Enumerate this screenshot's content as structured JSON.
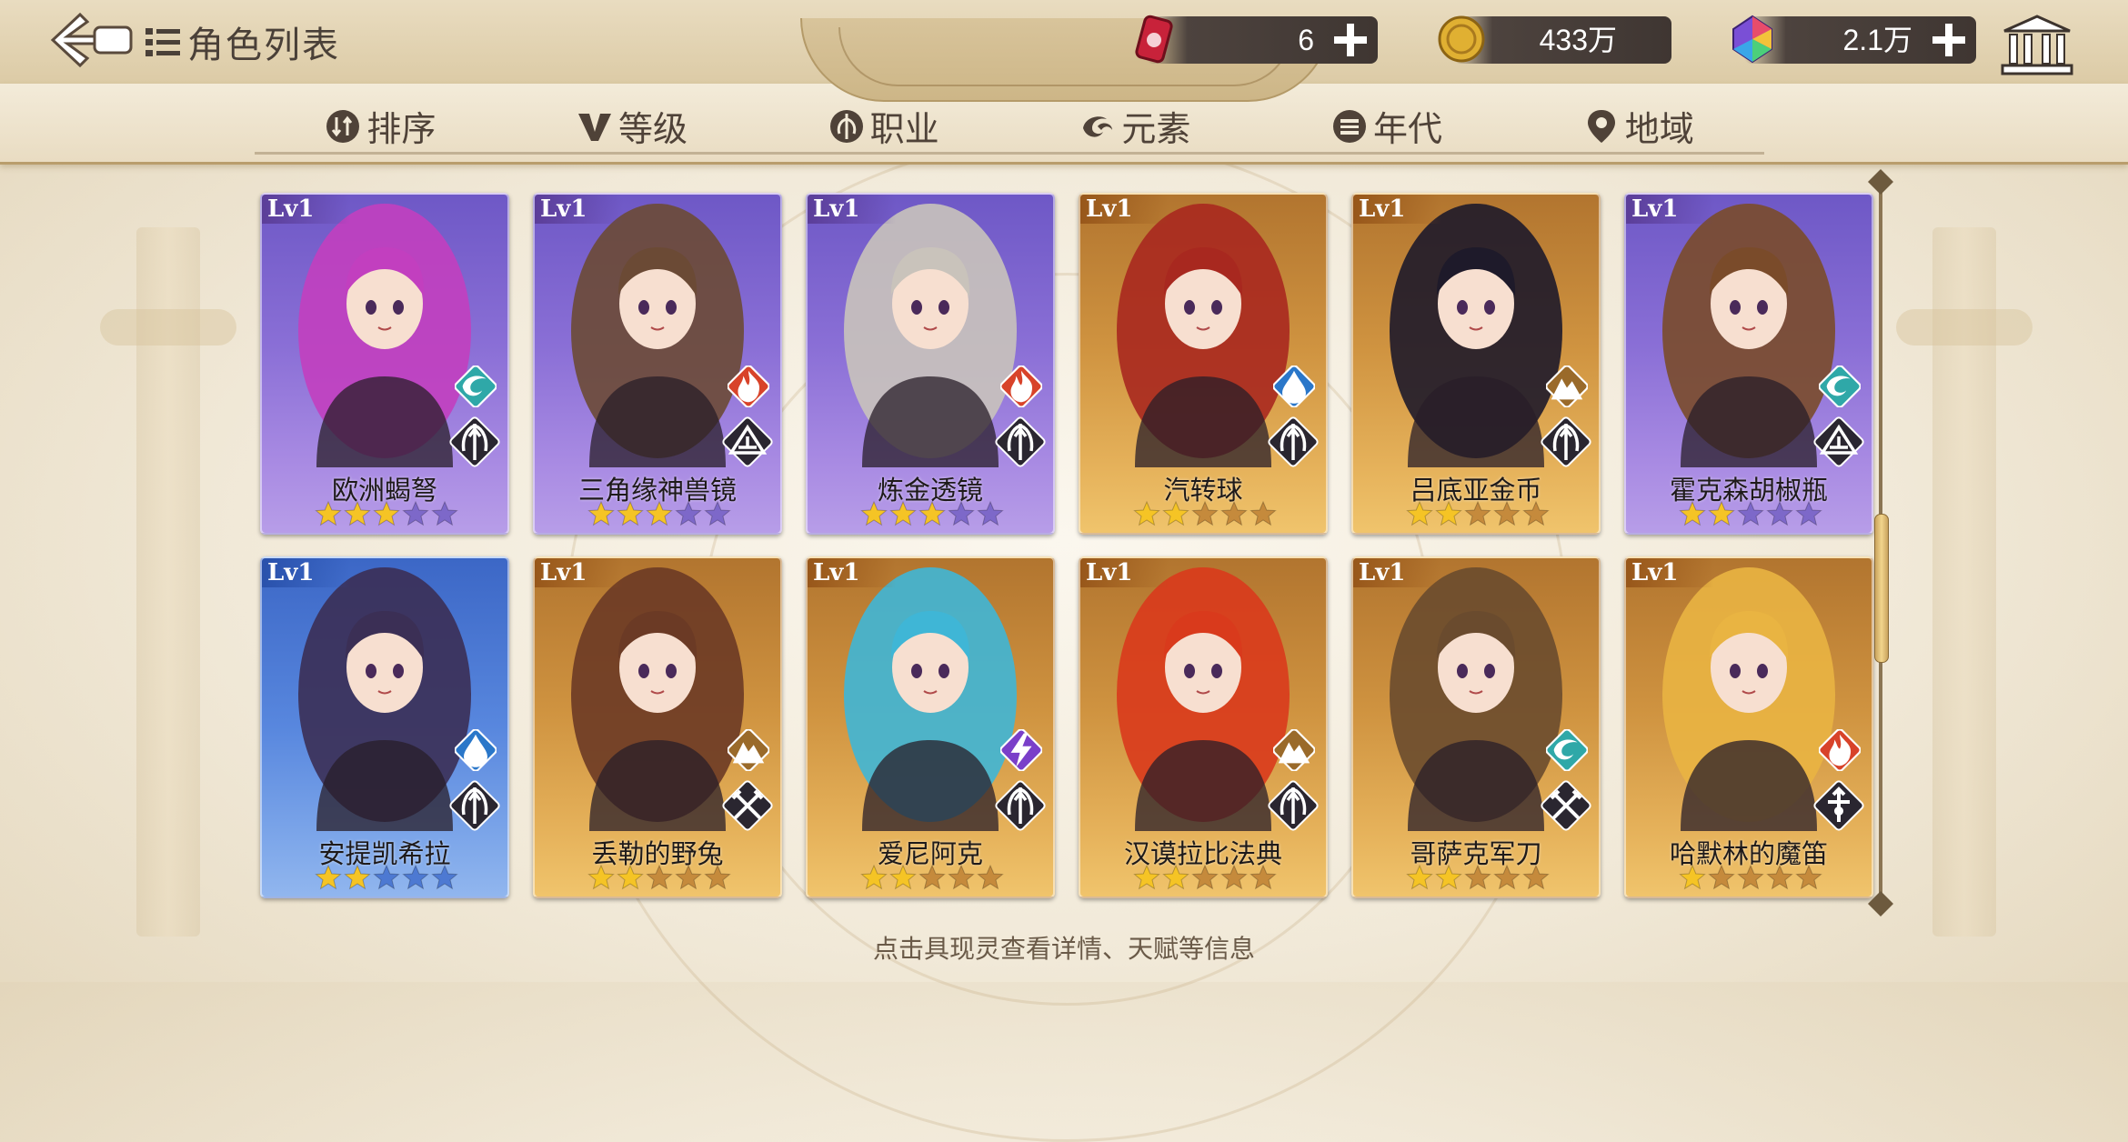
{
  "header": {
    "title": "角色列表",
    "resources": [
      {
        "name": "fuel-can",
        "value": "6",
        "color": "#c8223a"
      },
      {
        "name": "gold-coin",
        "value": "433万",
        "color": "#e0b032"
      },
      {
        "name": "rainbow-gem",
        "value": "2.1万",
        "color": "#7a4fd6"
      }
    ]
  },
  "tabs": [
    {
      "label": "排序",
      "icon": "sort-icon"
    },
    {
      "label": "等级",
      "icon": "level-v-icon"
    },
    {
      "label": "职业",
      "icon": "profession-icon"
    },
    {
      "label": "元素",
      "icon": "element-icon"
    },
    {
      "label": "年代",
      "icon": "era-icon"
    },
    {
      "label": "地域",
      "icon": "location-pin-icon"
    }
  ],
  "cards": [
    {
      "level": "Lv1",
      "name": "欧洲蝎弩",
      "rarity": "purple",
      "stars": 3,
      "max_stars": 5,
      "element": "wind",
      "class": "archer",
      "hair": "#c23fbf"
    },
    {
      "level": "Lv1",
      "name": "三角缘神兽镜",
      "rarity": "purple",
      "stars": 3,
      "max_stars": 5,
      "element": "fire",
      "class": "mage",
      "hair": "#6b4a35"
    },
    {
      "level": "Lv1",
      "name": "炼金透镜",
      "rarity": "purple",
      "stars": 3,
      "max_stars": 5,
      "element": "fire",
      "class": "archer",
      "hair": "#c9c3bb"
    },
    {
      "level": "Lv1",
      "name": "汽转球",
      "rarity": "gold",
      "stars": 2,
      "max_stars": 5,
      "element": "water",
      "class": "archer",
      "hair": "#a8281f"
    },
    {
      "level": "Lv1",
      "name": "吕底亚金币",
      "rarity": "gold",
      "stars": 2,
      "max_stars": 5,
      "element": "earth",
      "class": "archer",
      "hair": "#1e1a2a"
    },
    {
      "level": "Lv1",
      "name": "霍克森胡椒瓶",
      "rarity": "purple",
      "stars": 2,
      "max_stars": 5,
      "element": "wind",
      "class": "mage",
      "hair": "#7a4b2a"
    },
    {
      "level": "Lv1",
      "name": "安提凯希拉",
      "rarity": "blue",
      "stars": 2,
      "max_stars": 5,
      "element": "water",
      "class": "archer",
      "hair": "#3b2f55"
    },
    {
      "level": "Lv1",
      "name": "丢勒的野兔",
      "rarity": "gold",
      "stars": 2,
      "max_stars": 5,
      "element": "earth",
      "class": "warrior",
      "hair": "#6b3a25"
    },
    {
      "level": "Lv1",
      "name": "爱尼阿克",
      "rarity": "gold",
      "stars": 2,
      "max_stars": 5,
      "element": "thunder",
      "class": "archer",
      "hair": "#3fb6d6"
    },
    {
      "level": "Lv1",
      "name": "汉谟拉比法典",
      "rarity": "gold",
      "stars": 2,
      "max_stars": 5,
      "element": "earth",
      "class": "archer",
      "hair": "#d93a1c"
    },
    {
      "level": "Lv1",
      "name": "哥萨克军刀",
      "rarity": "gold",
      "stars": 2,
      "max_stars": 5,
      "element": "wind",
      "class": "warrior",
      "hair": "#6a4b2e"
    },
    {
      "level": "Lv1",
      "name": "哈默林的魔笛",
      "rarity": "gold",
      "stars": 1,
      "max_stars": 5,
      "element": "fire",
      "class": "support",
      "hair": "#e9b442"
    }
  ],
  "hint": "点击具现灵查看详情、天赋等信息",
  "colors": {
    "star_on": "#f5c425",
    "star_off_purple": "#7d68c9",
    "star_off_gold": "#c58a3c",
    "star_off_blue": "#4d79d2"
  }
}
